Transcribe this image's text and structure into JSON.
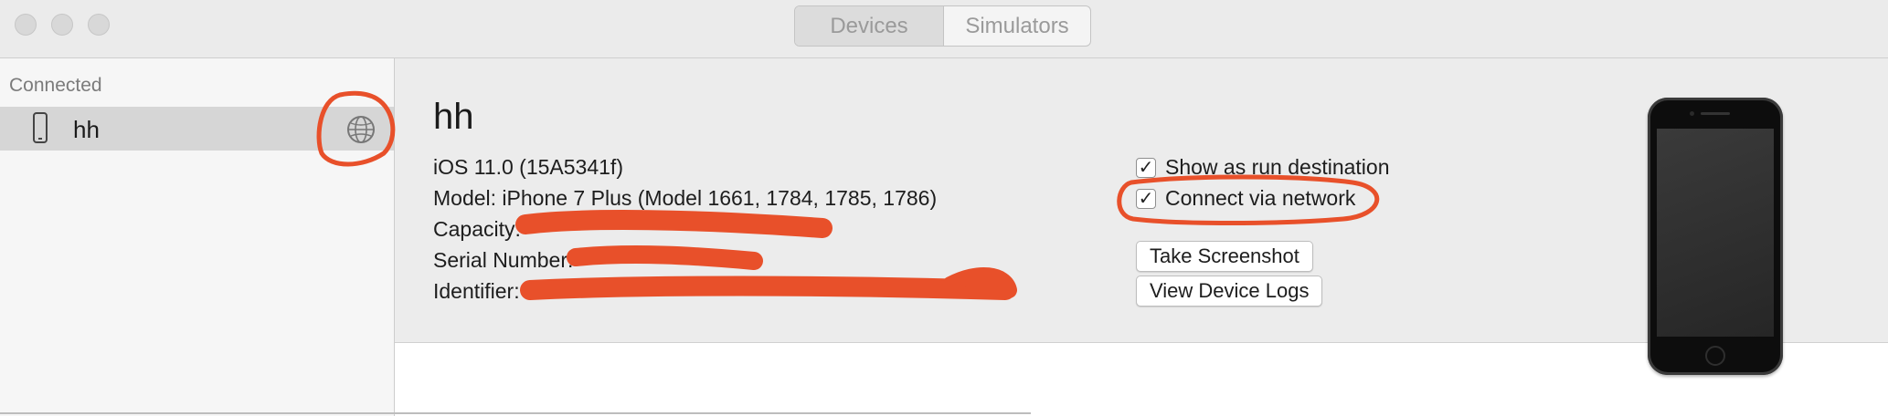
{
  "window": {
    "tabs": [
      {
        "label": "Devices",
        "selected": true
      },
      {
        "label": "Simulators",
        "selected": false
      }
    ]
  },
  "sidebar": {
    "section_header": "Connected",
    "devices": [
      {
        "name": "hh",
        "icon": "iphone-icon",
        "network_icon": "globe-icon",
        "selected": true
      }
    ]
  },
  "device": {
    "name": "hh",
    "os": "iOS 11.0 (15A5341f)",
    "model": "Model: iPhone 7 Plus (Model 1661, 1784, 1785, 1786)",
    "capacity_label": "Capacity:",
    "serial_label": "Serial Number:",
    "identifier_label": "Identifier:"
  },
  "options": {
    "show_run_destination": {
      "label": "Show as run destination",
      "checked": true
    },
    "connect_via_network": {
      "label": "Connect via network",
      "checked": true
    }
  },
  "buttons": {
    "take_screenshot": "Take Screenshot",
    "view_logs": "View Device Logs"
  },
  "colors": {
    "annotation": "#e8502a"
  }
}
